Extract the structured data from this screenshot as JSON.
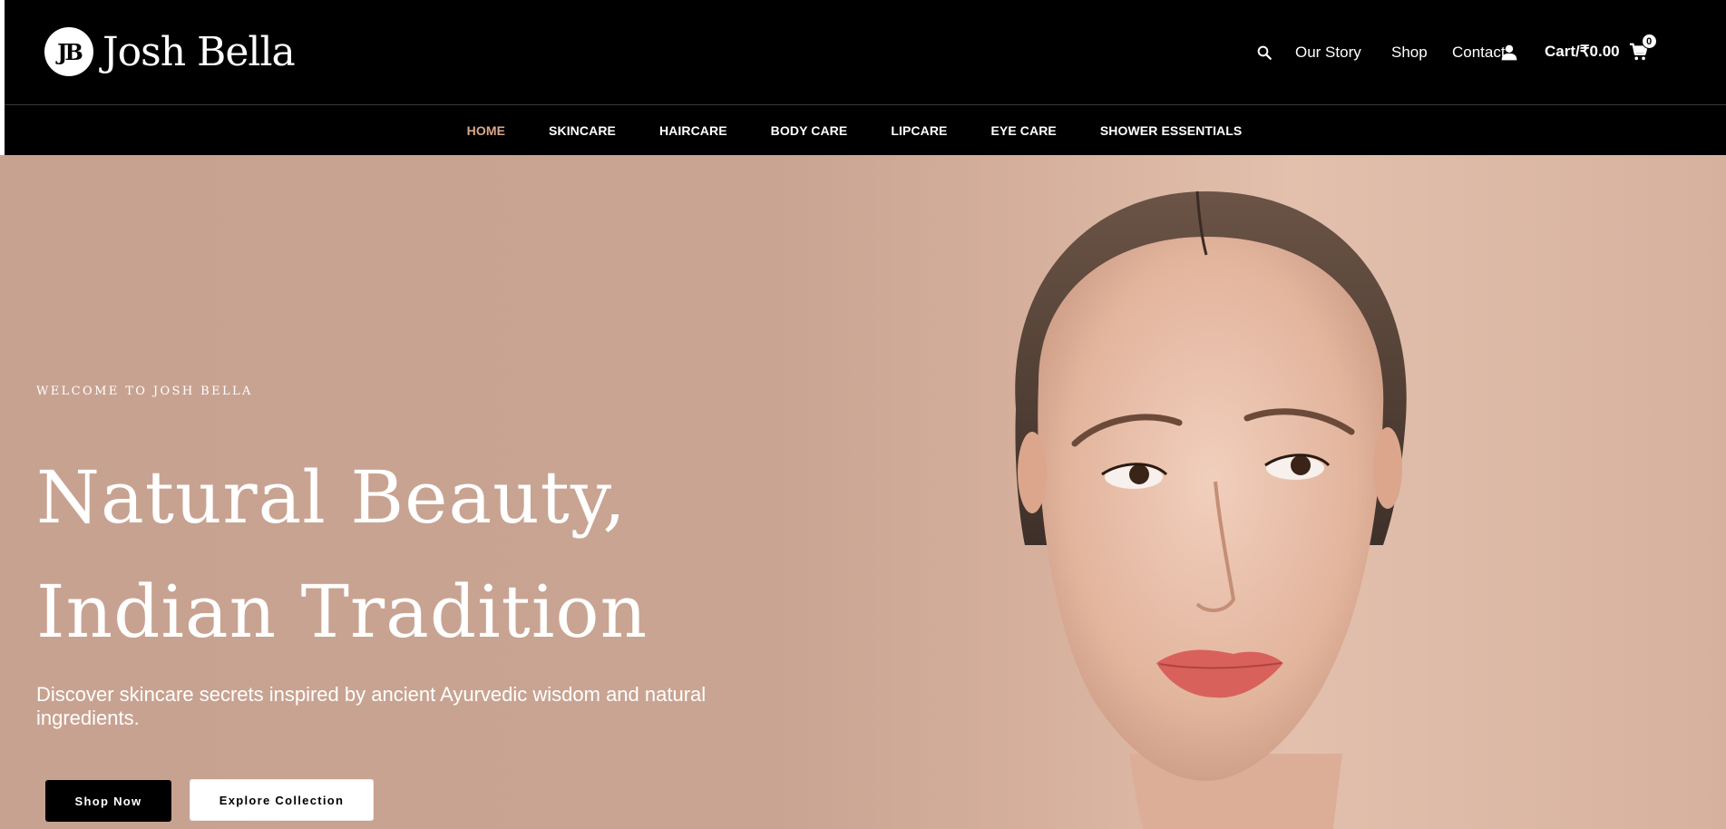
{
  "brand": {
    "logo_mark": "JB",
    "name": "Josh Bella"
  },
  "top_nav": {
    "search_icon": "search-icon",
    "links": [
      "Our Story",
      "Shop",
      "Contact"
    ],
    "account_icon": "user-icon",
    "cart_label": "Cart/₹0.00",
    "cart_count": "0",
    "cart_icon": "shopping-cart-icon"
  },
  "main_nav": {
    "items": [
      "HOME",
      "SKINCARE",
      "HAIRCARE",
      "BODY CARE",
      "LIPCARE",
      "EYE CARE",
      "SHOWER ESSENTIALS"
    ],
    "active": "HOME",
    "active_color": "#d9a98c"
  },
  "hero": {
    "eyebrow": "WELCOME TO JOSH BELLA",
    "title_line1": "Natural Beauty,",
    "title_line2": "Indian Tradition",
    "subtitle": "Discover skincare secrets inspired by ancient Ayurvedic wisdom and natural ingredients.",
    "primary_button": "Shop Now",
    "secondary_button": "Explore Collection",
    "background_color": "#c8a291"
  }
}
